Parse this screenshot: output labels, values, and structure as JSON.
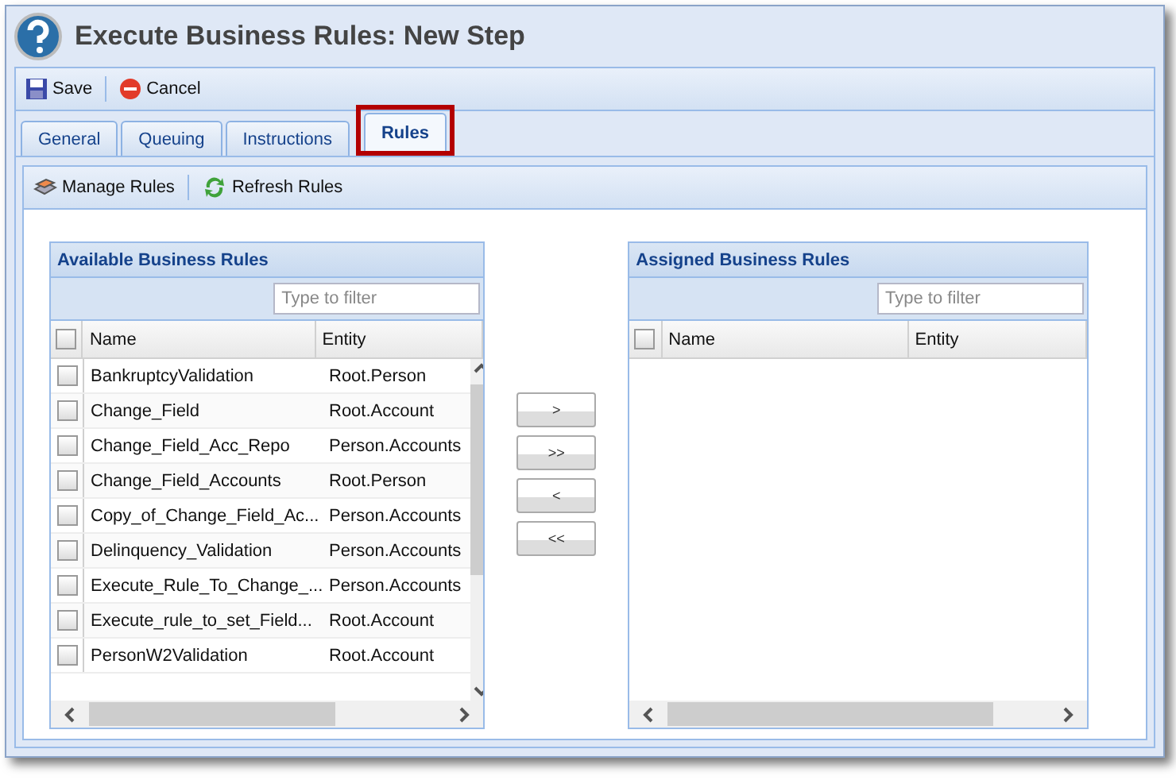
{
  "window": {
    "title": "Execute Business Rules: New Step"
  },
  "toolbar": [
    {
      "kind": "save",
      "label": "Save"
    },
    {
      "kind": "cancel",
      "label": "Cancel"
    }
  ],
  "tabs": [
    {
      "label": "General",
      "selected": false,
      "highlighted": false
    },
    {
      "label": "Queuing",
      "selected": false,
      "highlighted": false
    },
    {
      "label": "Instructions",
      "selected": false,
      "highlighted": false
    },
    {
      "label": "Rules",
      "selected": true,
      "highlighted": true
    }
  ],
  "rules_toolbar": [
    {
      "kind": "manage",
      "label": "Manage Rules"
    },
    {
      "kind": "refresh",
      "label": "Refresh Rules"
    }
  ],
  "available": {
    "title": "Available Business Rules",
    "filter": {
      "placeholder": "Type to filter"
    },
    "all_checked": false,
    "columns": [
      "Name",
      "Entity"
    ],
    "rows": [
      {
        "name": "BankruptcyValidation",
        "entity": "Root.Person",
        "checked": false
      },
      {
        "name": "Change_Field",
        "entity": "Root.Account",
        "checked": false
      },
      {
        "name": "Change_Field_Acc_Repo",
        "entity": "Person.Accounts",
        "checked": false
      },
      {
        "name": "Change_Field_Accounts",
        "entity": "Root.Person",
        "checked": false
      },
      {
        "name": "Copy_of_Change_Field_Ac...",
        "entity": "Person.Accounts",
        "checked": false
      },
      {
        "name": "Delinquency_Validation",
        "entity": "Person.Accounts",
        "checked": false
      },
      {
        "name": "Execute_Rule_To_Change_...",
        "entity": "Person.Accounts",
        "checked": false
      },
      {
        "name": "Execute_rule_to_set_Field...",
        "entity": "Root.Account",
        "checked": false
      },
      {
        "name": "PersonW2Validation",
        "entity": "Root.Account",
        "checked": false
      }
    ]
  },
  "move_buttons": [
    ">",
    ">>",
    "<",
    "<<"
  ],
  "assigned": {
    "title": "Assigned Business Rules",
    "filter": {
      "placeholder": "Type to filter"
    },
    "all_checked": false,
    "columns": [
      "Name",
      "Entity"
    ]
  }
}
